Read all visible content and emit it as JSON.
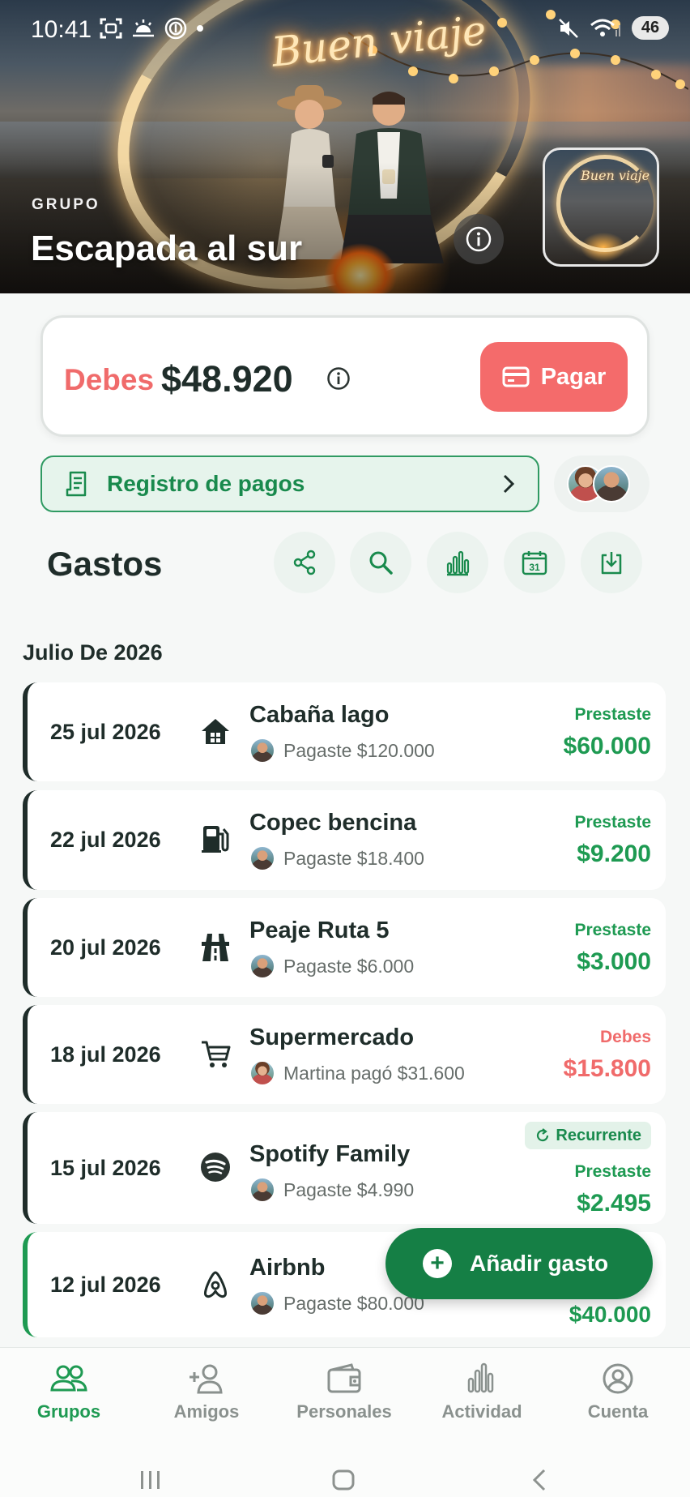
{
  "status_bar": {
    "time": "10:41",
    "battery": "46"
  },
  "hero": {
    "neon_sign": "Buen viaje",
    "kicker": "GRUPO",
    "title": "Escapada al sur"
  },
  "balance": {
    "label": "Debes",
    "amount": "$48.920",
    "pay_label": "Pagar"
  },
  "payments_log": {
    "label": "Registro de pagos"
  },
  "expenses_section": {
    "title": "Gastos",
    "tools": [
      "share-icon",
      "search-icon",
      "stats-icon",
      "calendar-icon",
      "download-icon"
    ],
    "calendar_day": "31",
    "month": "Julio De 2026"
  },
  "expenses": [
    {
      "date": "25 jul 2026",
      "icon": "house-icon",
      "title": "Cabaña lago",
      "sub": "Pagaste $120.000",
      "status": "Prestaste",
      "amount": "$60.000",
      "kind": "pos",
      "recurring": ""
    },
    {
      "date": "22 jul 2026",
      "icon": "fuel-icon",
      "title": "Copec bencina",
      "sub": "Pagaste $18.400",
      "status": "Prestaste",
      "amount": "$9.200",
      "kind": "pos",
      "recurring": ""
    },
    {
      "date": "20 jul 2026",
      "icon": "road-icon",
      "title": "Peaje Ruta 5",
      "sub": "Pagaste $6.000",
      "status": "Prestaste",
      "amount": "$3.000",
      "kind": "pos",
      "recurring": ""
    },
    {
      "date": "18 jul 2026",
      "icon": "cart-icon",
      "title": "Supermercado",
      "sub": "Martina pagó $31.600",
      "status": "Debes",
      "amount": "$15.800",
      "kind": "neg",
      "recurring": ""
    },
    {
      "date": "15 jul 2026",
      "icon": "spotify-icon",
      "title": "Spotify Family",
      "sub": "Pagaste $4.990",
      "status": "Prestaste",
      "amount": "$2.495",
      "kind": "pos",
      "recurring": "Recurrente"
    },
    {
      "date": "12 jul 2026",
      "icon": "airbnb-icon",
      "title": "Airbnb",
      "sub": "Pagaste $80.000",
      "status": "",
      "amount": "$40.000",
      "kind": "pos",
      "recurring": ""
    }
  ],
  "fab": {
    "label": "Añadir gasto"
  },
  "bottom_nav": [
    {
      "label": "Grupos",
      "icon": "groups-icon",
      "active": true
    },
    {
      "label": "Amigos",
      "icon": "add-friend-icon",
      "active": false
    },
    {
      "label": "Personales",
      "icon": "wallet-icon",
      "active": false
    },
    {
      "label": "Actividad",
      "icon": "activity-icon",
      "active": false
    },
    {
      "label": "Cuenta",
      "icon": "account-icon",
      "active": false
    }
  ],
  "colors": {
    "accent_green": "#1e9a52",
    "debt_red": "#f06b6b",
    "pay_button": "#f46b6b",
    "fab": "#157f45",
    "text_dark": "#1f2d2a"
  }
}
